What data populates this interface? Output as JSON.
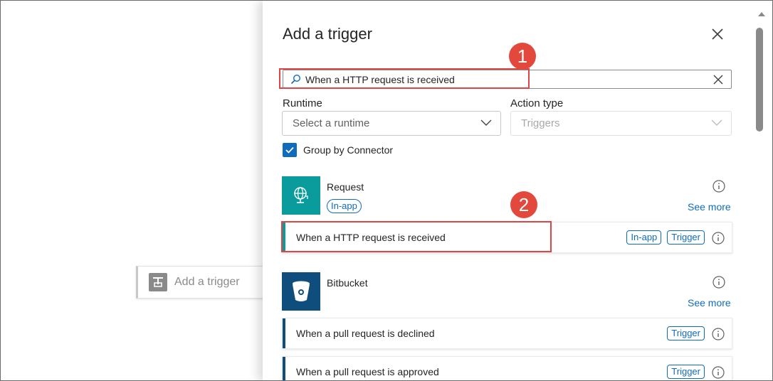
{
  "canvas": {
    "trigger_placeholder": "Add a trigger"
  },
  "panel": {
    "title": "Add a trigger",
    "search": {
      "value": "When a HTTP request is received"
    },
    "runtime": {
      "label": "Runtime",
      "placeholder": "Select a runtime"
    },
    "action_type": {
      "label": "Action type",
      "value": "Triggers"
    },
    "group_by_connector": {
      "label": "Group by Connector",
      "checked": true
    },
    "connectors": [
      {
        "name": "Request",
        "badge": "In-app",
        "see_more": "See more",
        "tile_color": "#0a9b9c",
        "operations": [
          {
            "label": "When a HTTP request is received",
            "badges": [
              "In-app",
              "Trigger"
            ]
          }
        ]
      },
      {
        "name": "Bitbucket",
        "see_more": "See more",
        "tile_color": "#0e4d7c",
        "operations": [
          {
            "label": "When a pull request is declined",
            "badges": [
              "Trigger"
            ]
          },
          {
            "label": "When a pull request is approved",
            "badges": [
              "Trigger"
            ]
          }
        ]
      }
    ]
  },
  "callouts": [
    "1",
    "2"
  ],
  "colors": {
    "accent": "#0f6cbd",
    "highlight": "#e04545",
    "callout": "#e2483b"
  }
}
